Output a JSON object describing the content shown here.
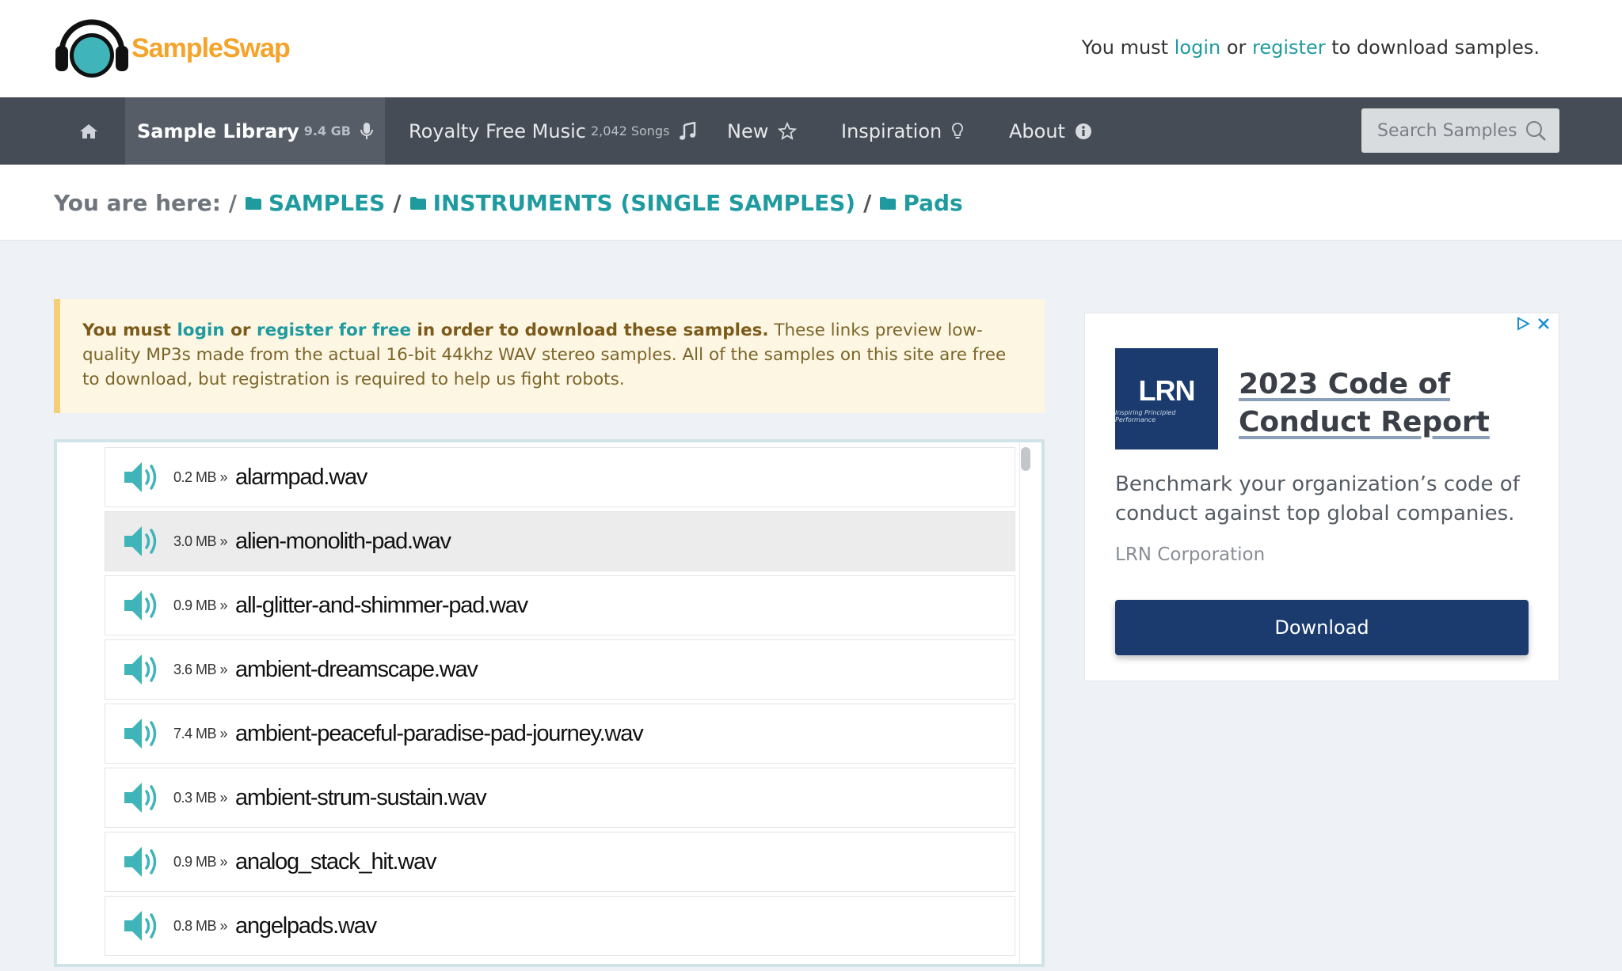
{
  "header": {
    "logo_text": "SampleSwap",
    "login_prefix": "You must ",
    "login_link": "login",
    "login_mid": " or ",
    "register_link": "register",
    "login_suffix": " to download samples."
  },
  "nav": {
    "home_icon": "home-icon",
    "items": [
      {
        "label": "Sample Library",
        "sub": "9.4 GB",
        "icon": "microphone-icon"
      },
      {
        "label": "Royalty Free Music",
        "sub": "2,042 Songs",
        "icon": "music-note-icon"
      },
      {
        "label": "New",
        "sub": "",
        "icon": "star-icon"
      },
      {
        "label": "Inspiration",
        "sub": "",
        "icon": "lightbulb-icon"
      },
      {
        "label": "About",
        "sub": "",
        "icon": "info-icon"
      }
    ],
    "search_placeholder": "Search Samples"
  },
  "breadcrumb": {
    "prefix": "You are here: /",
    "items": [
      "SAMPLES",
      "INSTRUMENTS (SINGLE SAMPLES)",
      "Pads"
    ],
    "separator": "/"
  },
  "notice": {
    "bold_1": "You must ",
    "login": "login",
    "bold_2": " or ",
    "register": "register for free",
    "bold_3": " in order to download these samples.",
    "text": " These links preview low-quality MP3s made from the actual 16-bit 44khz WAV stereo samples. All of the samples on this site are free to download, but registration is required to help us fight robots."
  },
  "samples": [
    {
      "size": "0.2 MB »",
      "name": "alarmpad.wav"
    },
    {
      "size": "3.0 MB »",
      "name": "alien-monolith-pad.wav"
    },
    {
      "size": "0.9 MB »",
      "name": "all-glitter-and-shimmer-pad.wav"
    },
    {
      "size": "3.6 MB »",
      "name": "ambient-dreamscape.wav"
    },
    {
      "size": "7.4 MB »",
      "name": "ambient-peaceful-paradise-pad-journey.wav"
    },
    {
      "size": "0.3 MB »",
      "name": "ambient-strum-sustain.wav"
    },
    {
      "size": "0.9 MB »",
      "name": "analog_stack_hit.wav"
    },
    {
      "size": "0.8 MB »",
      "name": "angelpads.wav"
    }
  ],
  "ad": {
    "logo_text": "LRN",
    "logo_tagline": "Inspiring Principled Performance",
    "title": "2023 Code of Conduct Report",
    "description": "Benchmark your organization’s code of conduct against top global companies.",
    "company": "LRN Corporation",
    "button": "Download"
  },
  "colors": {
    "accent": "#1f9ba0",
    "nav_bg": "#464c55",
    "logo_orange": "#f5a32b",
    "ad_navy": "#1b3b6f"
  }
}
